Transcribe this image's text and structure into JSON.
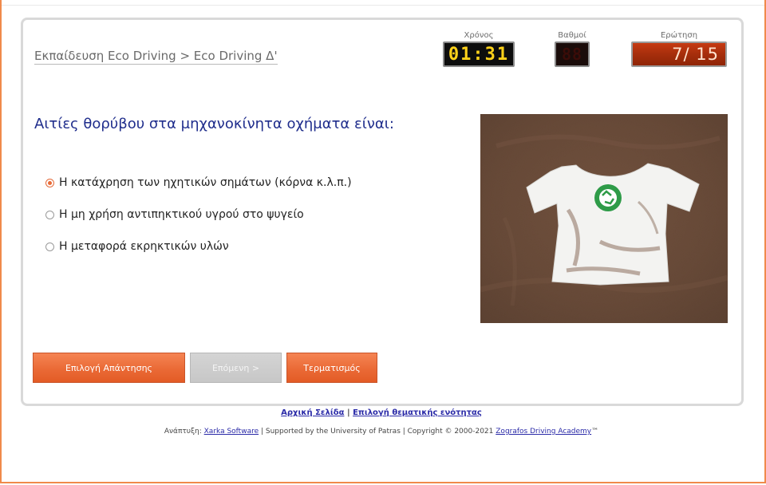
{
  "header": {
    "breadcrumb": "Εκπαίδευση Eco Driving > Eco Driving Δ'",
    "meters": {
      "time_label": "Χρόνος",
      "time_value": "01:31",
      "score_label": "Βαθμοί",
      "score_value": "88",
      "question_label": "Ερώτηση",
      "question_value": "7/ 15"
    }
  },
  "question": {
    "title": "Αιτίες θορύβου στα μηχανοκίνητα οχήματα είναι:",
    "options": [
      {
        "label": "Η κατάχρηση των ηχητικών σημάτων (κόρνα κ.λ.π.)",
        "selected": true
      },
      {
        "label": "Η μη χρήση αντιπηκτικού υγρού στο ψυγείο",
        "selected": false
      },
      {
        "label": "Η μεταφορά εκρηκτικών υλών",
        "selected": false
      }
    ]
  },
  "image": {
    "subject": "white t-shirt with green recycling logo on sand",
    "colors": {
      "sand": "#5e4030",
      "shirt": "#f4f4f2",
      "logo": "#2e9b48"
    }
  },
  "buttons": {
    "select_answer": "Επιλογή Απάντησης",
    "next": "Επόμενη >",
    "finish": "Τερματισμός"
  },
  "footer": {
    "home_link": "Αρχική Σελίδα",
    "separator": "|",
    "topic_link": "Επιλογή θεματικής ενότητας",
    "dev_prefix": "Ανάπτυξη:",
    "dev_link": "Xarka Software",
    "credits_mid": "| Supported by the University of Patras | Copyright © 2000-2021",
    "academy_link": "Zografos Driving Academy",
    "trademark": "™"
  },
  "colors": {
    "accent": "#ea6a36",
    "title_blue": "#1f2d8c",
    "frame": "#f08a4b",
    "lcd_yellow": "#ffd21a"
  }
}
